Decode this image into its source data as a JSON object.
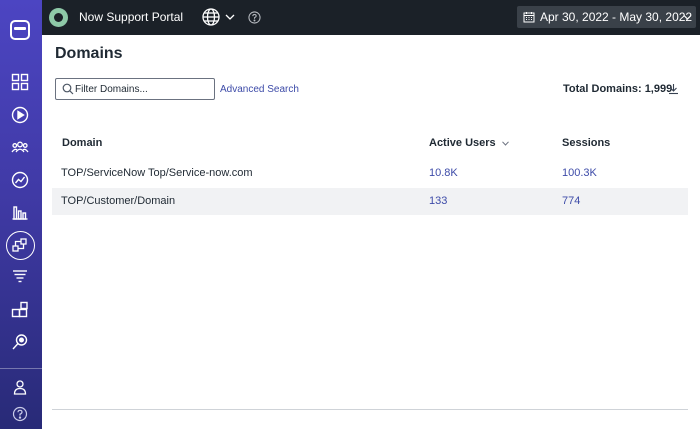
{
  "app": {
    "brand_name": "Now Support Portal",
    "date_range": "Apr 30, 2022 - May 30, 2022"
  },
  "sidebar": {
    "items": [
      {
        "name": "dashboard-icon"
      },
      {
        "name": "play-icon"
      },
      {
        "name": "users-icon"
      },
      {
        "name": "analytics-icon"
      },
      {
        "name": "bar-chart-icon"
      },
      {
        "name": "domains-icon",
        "active": true
      },
      {
        "name": "funnel-icon"
      },
      {
        "name": "blocks-icon"
      },
      {
        "name": "search-insight-icon"
      }
    ],
    "bottom": [
      {
        "name": "user-icon"
      },
      {
        "name": "help-icon"
      }
    ]
  },
  "page": {
    "title": "Domains",
    "filter_placeholder": "Filter Domains...",
    "advanced_search": "Advanced Search",
    "total_domains": "Total Domains: 1,999"
  },
  "table": {
    "columns": [
      "Domain",
      "Active Users",
      "Sessions"
    ],
    "rows": [
      {
        "domain": "TOP/ServiceNow Top/Service-now.com",
        "active_users": "10.8K",
        "sessions": "100.3K"
      },
      {
        "domain": "TOP/Customer/Domain",
        "active_users": "133",
        "sessions": "774"
      }
    ]
  },
  "colors": {
    "sidebar_top": "#4c45c2",
    "sidebar_bottom": "#282a77",
    "topbar": "#1b2128",
    "link": "#3d4ba8",
    "row_alt": "#f1f2f4"
  }
}
